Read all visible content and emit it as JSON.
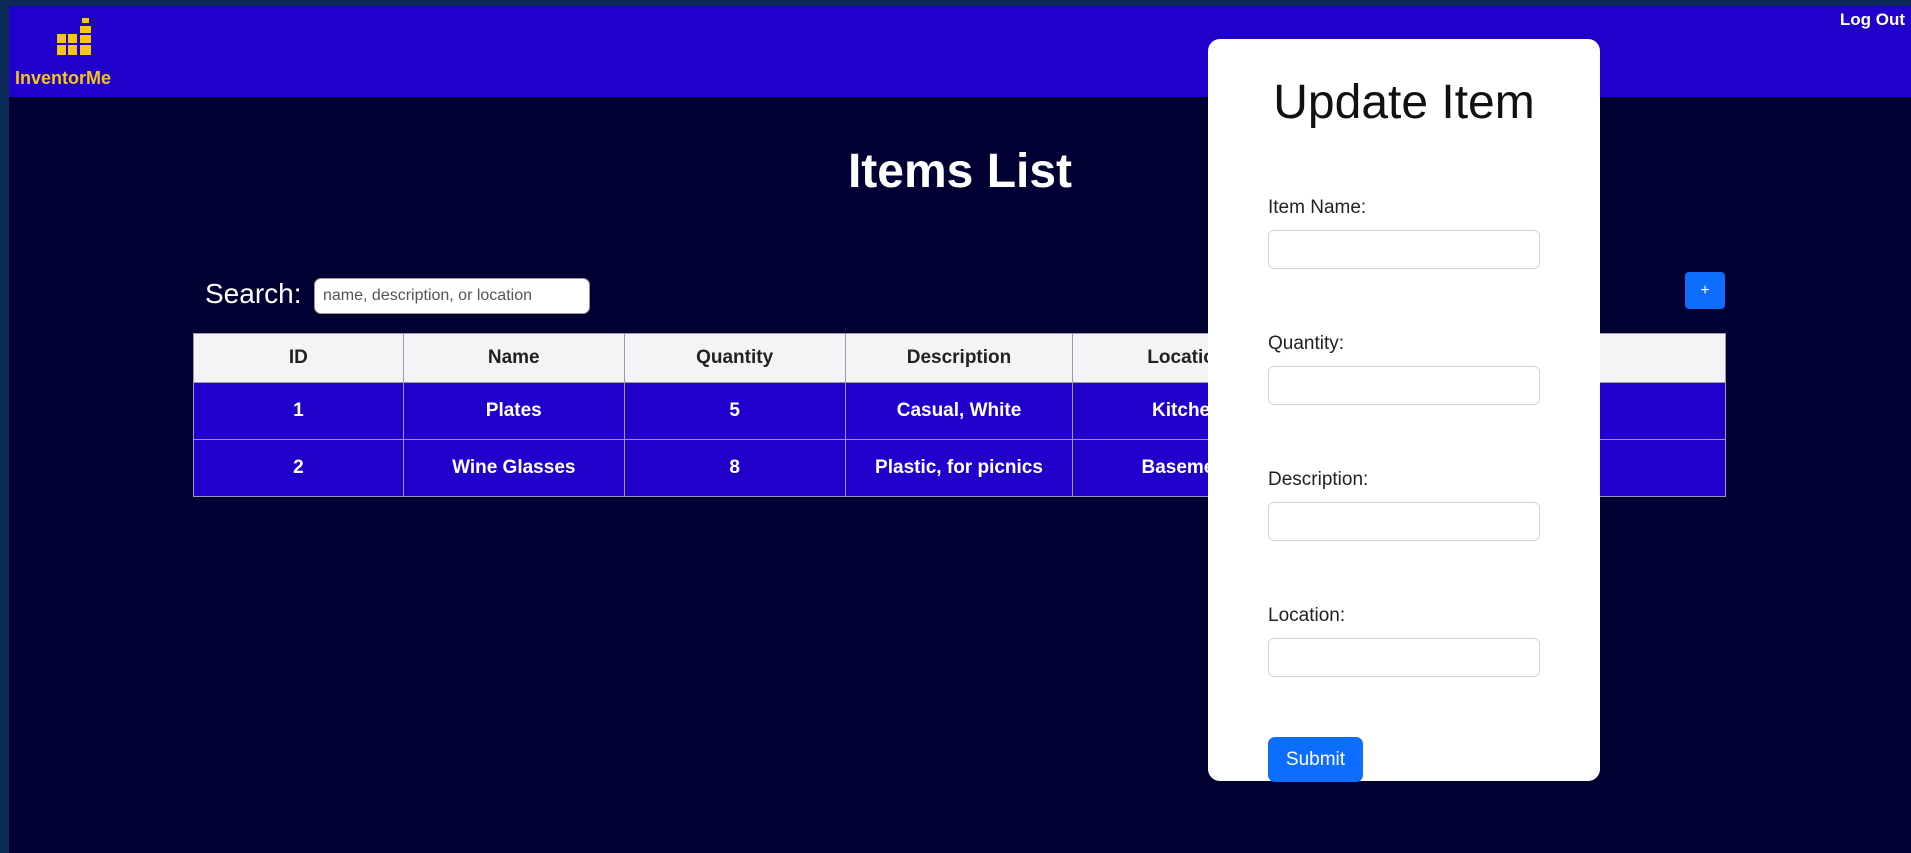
{
  "header": {
    "brand_name": "InventorMe",
    "logout_label": "Log Out",
    "logo_icon": "bar-blocks-icon",
    "brand_color": "#f5c518",
    "background_color": "#2200cc"
  },
  "main": {
    "title": "Items List",
    "search_label": "Search:",
    "search_placeholder": "name, description, or location",
    "add_label": "+",
    "table": {
      "columns": [
        "ID",
        "Name",
        "Quantity",
        "Description",
        "Location"
      ],
      "delete_icon": "trash-icon",
      "rows": [
        {
          "id": "1",
          "name": "Plates",
          "quantity": "5",
          "description": "Casual, White",
          "location": "Kitchen"
        },
        {
          "id": "2",
          "name": "Wine Glasses",
          "quantity": "8",
          "description": "Plastic, for picnics",
          "location": "Basement"
        }
      ]
    }
  },
  "modal": {
    "title": "Update Item",
    "fields": [
      {
        "label": "Item Name:",
        "value": ""
      },
      {
        "label": "Quantity:",
        "value": ""
      },
      {
        "label": "Description:",
        "value": ""
      },
      {
        "label": "Location:",
        "value": ""
      }
    ],
    "submit_label": "Submit"
  }
}
